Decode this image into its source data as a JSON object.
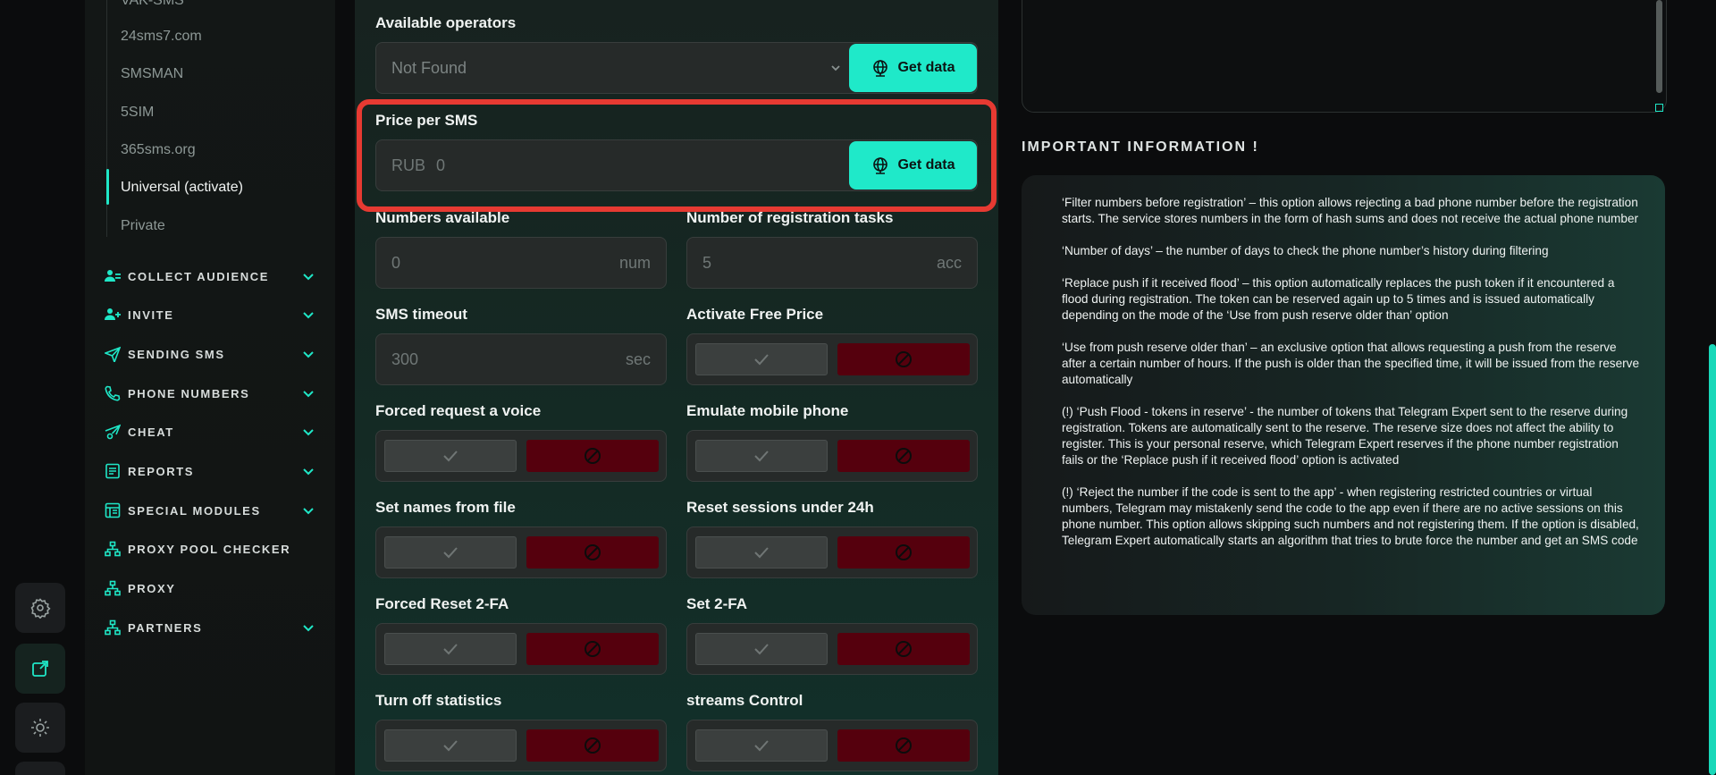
{
  "rail": {
    "buttons": [
      {
        "name": "settings-gear-icon"
      },
      {
        "name": "open-external-icon"
      },
      {
        "name": "theme-sun-icon"
      }
    ]
  },
  "sidebar": {
    "sub_items": [
      {
        "label": "VAK-SMS",
        "active": false
      },
      {
        "label": "24sms7.com",
        "active": false
      },
      {
        "label": "SMSMAN",
        "active": false
      },
      {
        "label": "5SIM",
        "active": false
      },
      {
        "label": "365sms.org",
        "active": false
      },
      {
        "label": "Universal (activate)",
        "active": true
      },
      {
        "label": "Private",
        "active": false
      }
    ],
    "nav": [
      {
        "label": "COLLECT AUDIENCE",
        "icon": "users-icon",
        "chevron": true
      },
      {
        "label": "INVITE",
        "icon": "user-add-icon",
        "chevron": true
      },
      {
        "label": "SENDING SMS",
        "icon": "paper-plane-icon",
        "chevron": true
      },
      {
        "label": "PHONE NUMBERS",
        "icon": "phone-icon",
        "chevron": true
      },
      {
        "label": "CHEAT",
        "icon": "plane-gear-icon",
        "chevron": true
      },
      {
        "label": "REPORTS",
        "icon": "report-icon",
        "chevron": true
      },
      {
        "label": "SPECIAL MODULES",
        "icon": "modules-icon",
        "chevron": true
      },
      {
        "label": "PROXY POOL CHECKER",
        "icon": "network-icon",
        "chevron": false
      },
      {
        "label": "PROXY",
        "icon": "network-icon",
        "chevron": false
      },
      {
        "label": "PARTNERS",
        "icon": "network-icon",
        "chevron": true
      }
    ]
  },
  "form": {
    "operators": {
      "label": "Available operators",
      "value": "Not Found",
      "button": "Get data"
    },
    "price": {
      "label": "Price per SMS",
      "prefix": "RUB",
      "value": "0",
      "button": "Get data"
    },
    "numbers_available": {
      "label": "Numbers available",
      "value": "0",
      "unit": "num"
    },
    "reg_tasks": {
      "label": "Number of registration tasks",
      "value": "5",
      "unit": "acc"
    },
    "sms_timeout": {
      "label": "SMS timeout",
      "value": "300",
      "unit": "sec"
    },
    "toggles": [
      {
        "label": "Activate Free Price",
        "state": "off"
      },
      {
        "label": "Forced request a voice",
        "state": "off"
      },
      {
        "label": "Emulate mobile phone",
        "state": "off"
      },
      {
        "label": "Set names from file",
        "state": "off"
      },
      {
        "label": "Reset sessions under 24h",
        "state": "off"
      },
      {
        "label": "Forced Reset 2-FA",
        "state": "off"
      },
      {
        "label": "Set 2-FA",
        "state": "off"
      },
      {
        "label": "Turn off statistics",
        "state": "off"
      },
      {
        "label": "streams Control",
        "state": "off"
      }
    ]
  },
  "info": {
    "title": "IMPORTANT INFORMATION !",
    "paragraphs": [
      "‘Filter numbers before registration’ – this option allows rejecting a bad phone number before the registration starts. The service stores numbers in the form of hash sums and does not receive the actual phone number",
      "‘Number of days’ – the number of days to check the phone number’s history during filtering",
      "‘Replace push if it received flood’ – this option automatically replaces the push token if it encountered a flood during registration. The token can be reserved again up to 5 times and is issued automatically depending on the mode of the ‘Use from push reserve older than’ option",
      "‘Use from push reserve older than’ – an exclusive option that allows requesting a push from the reserve after a certain number of hours. If the push is older than the specified time, it will be issued from the reserve automatically",
      "(!) ‘Push Flood - tokens in reserve’ - the number of tokens that Telegram Expert sent to the reserve during registration. Tokens are automatically sent to the reserve. The reserve size does not affect the ability to register. This is your personal reserve, which Telegram Expert reserves if the phone number registration fails or the ‘Replace push if it received flood’ option is activated",
      "(!) ‘Reject the number if the code is sent to the app’ - when registering restricted countries or virtual numbers, Telegram may mistakenly send the code to the app even if there are no active sessions on this phone number. This option allows skipping such numbers and not registering them. If the option is disabled, Telegram Expert automatically starts an algorithm that tries to brute force the number and get an SMS code"
    ]
  },
  "colors": {
    "accent": "#1fe9c9",
    "danger": "#55000d",
    "highlight": "#e63a32"
  }
}
